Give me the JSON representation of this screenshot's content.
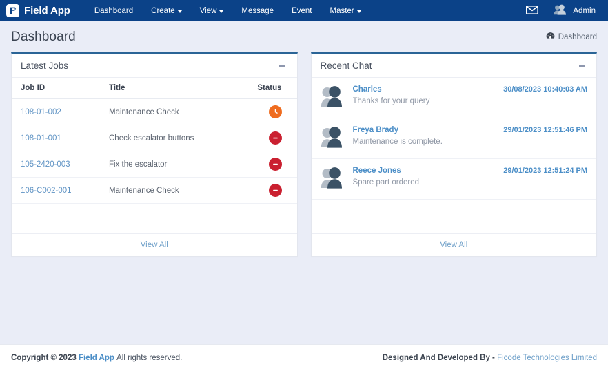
{
  "theme": {
    "navbar_bg": "#0b4288",
    "page_bg": "#eaedf7",
    "panel_border_top": "#2a6496",
    "link": "#5f93c4",
    "status_pending": "#ef6c1f",
    "status_blocked": "#ca2030"
  },
  "navbar": {
    "brand": "Field App",
    "brand_logo_icon": "flag-f-logo-icon",
    "links": [
      {
        "label": "Dashboard",
        "has_caret": false,
        "icon": ""
      },
      {
        "label": "Create",
        "has_caret": true,
        "icon": "chevron-down-icon"
      },
      {
        "label": "View",
        "has_caret": true,
        "icon": "chevron-down-icon"
      },
      {
        "label": "Message",
        "has_caret": false,
        "icon": ""
      },
      {
        "label": "Event",
        "has_caret": false,
        "icon": ""
      },
      {
        "label": "Master",
        "has_caret": true,
        "icon": "chevron-down-icon"
      }
    ],
    "mail_icon": "envelope-icon",
    "user_icon": "users-avatar-icon",
    "user_label": "Admin"
  },
  "page": {
    "title": "Dashboard",
    "breadcrumb_icon": "tachometer-dashboard-icon",
    "breadcrumb_label": "Dashboard"
  },
  "latest_jobs": {
    "title": "Latest Jobs",
    "collapse_icon": "minus-icon",
    "columns": [
      "Job ID",
      "Title",
      "Status"
    ],
    "rows": [
      {
        "job_id": "108-01-002",
        "title": "Maintenance Check",
        "status_icon": "clock-icon",
        "status_kind": "clock"
      },
      {
        "job_id": "108-01-001",
        "title": "Check escalator buttons",
        "status_icon": "minus-circle-icon",
        "status_kind": "ban"
      },
      {
        "job_id": "105-2420-003",
        "title": "Fix the escalator",
        "status_icon": "minus-circle-icon",
        "status_kind": "ban"
      },
      {
        "job_id": "106-C002-001",
        "title": "Maintenance Check",
        "status_icon": "minus-circle-icon",
        "status_kind": "ban"
      }
    ],
    "view_all": "View All"
  },
  "recent_chat": {
    "title": "Recent Chat",
    "collapse_icon": "minus-icon",
    "items": [
      {
        "avatar_icon": "users-avatar-icon",
        "name": "Charles",
        "message": "Thanks for your query",
        "time": "30/08/2023 10:40:03 AM"
      },
      {
        "avatar_icon": "users-avatar-icon",
        "name": "Freya Brady",
        "message": "Maintenance is complete.",
        "time": "29/01/2023 12:51:46 PM"
      },
      {
        "avatar_icon": "users-avatar-icon",
        "name": "Reece Jones",
        "message": "Spare part ordered",
        "time": "29/01/2023 12:51:24 PM"
      }
    ],
    "view_all": "View All"
  },
  "footer": {
    "copyright_prefix": "Copyright © 2023",
    "brand": "Field App",
    "copyright_suffix": "All rights reserved.",
    "credit_prefix": "Designed And Developed By -",
    "credit_link": "Ficode Technologies Limited"
  }
}
